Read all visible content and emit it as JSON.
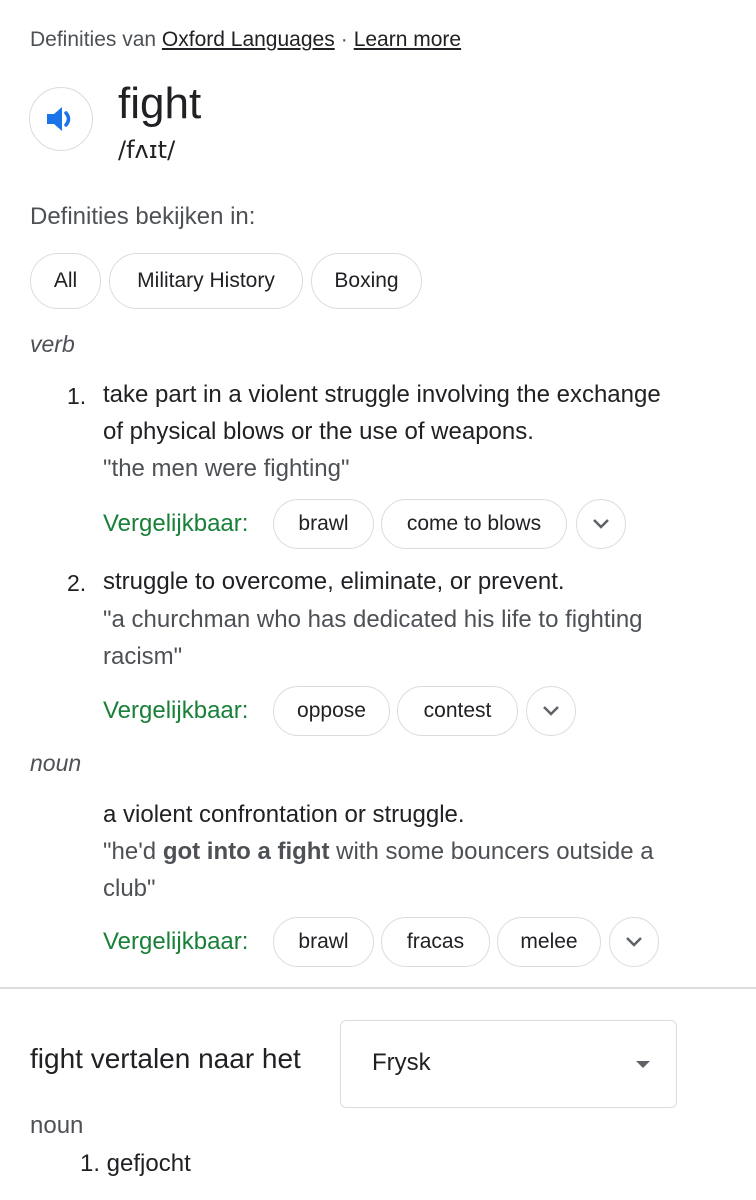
{
  "attribution": {
    "prefix": "Definities van",
    "source_link": "Oxford Languages",
    "separator": "·",
    "learn_more": "Learn more"
  },
  "entry": {
    "word": "fight",
    "phonetic": "/fʌɪt/",
    "speaker_icon": "volume-icon"
  },
  "see_in": {
    "label": "Definities bekijken in:",
    "chips": [
      "All",
      "Military History",
      "Boxing"
    ]
  },
  "similar_label": "Vergelijkbaar:",
  "verb": {
    "pos": "verb",
    "definitions": [
      {
        "number": "1.",
        "line1": "take part in a violent struggle involving the exchange",
        "line2": "of physical blows or the use of weapons.",
        "example": "\"the men were fighting\"",
        "similar": [
          "brawl",
          "come to blows"
        ]
      },
      {
        "number": "2.",
        "line1": "struggle to overcome, eliminate, or prevent.",
        "example_line1": "\"a churchman who has dedicated his life to fighting",
        "example_line2": "racism\"",
        "similar": [
          "oppose",
          "contest"
        ]
      }
    ]
  },
  "noun": {
    "pos": "noun",
    "definition": "a violent confrontation or struggle.",
    "example_pre": "\"he'd ",
    "example_bold": "got into a fight",
    "example_post": " with some bouncers outside a",
    "example_line2": "club\"",
    "similar": [
      "brawl",
      "fracas",
      "melee"
    ]
  },
  "translate": {
    "title": "fight vertalen naar het",
    "language": "Frysk",
    "pos": "noun",
    "items": [
      "1. gefjocht"
    ]
  },
  "colors": {
    "similar_label": "#188038",
    "speaker": "#1a73e8",
    "chip_border": "#dadce0"
  }
}
